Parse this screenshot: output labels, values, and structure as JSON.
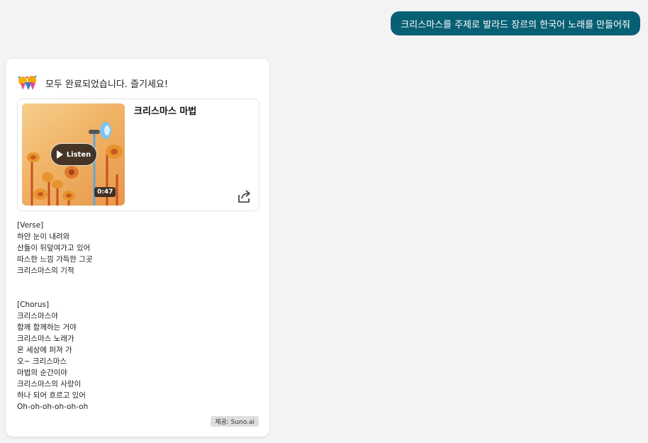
{
  "user_message": "크리스마스를 주제로 발라드 장르의 한국어 노래를 만들어줘",
  "response": {
    "icon": "party-popper-icon",
    "status_text": "모두 완료되었습니다. 즐기세요!",
    "song": {
      "title": "크리스마스 마법",
      "listen_label": "Listen",
      "duration": "0:47"
    },
    "lyrics": {
      "verse_label": "[Verse]",
      "verse": [
        "하얀 눈이 내려와",
        "산들이 뒤덮여가고 있어",
        "따스한 느낌 가득한 그곳",
        "크리스마스의 기적"
      ],
      "chorus_label": "[Chorus]",
      "chorus": [
        "크리스마스야",
        "함께 함께하는 거야",
        "크리스마스 노래가",
        "온 세상에 퍼져 가",
        "오~ 크리스마스",
        "마법의 순간이야",
        "크리스마스의 사랑이",
        "하나 되어 흐르고 있어",
        "Oh-oh-oh-oh-oh-oh"
      ]
    },
    "source_label": "제공: Suno.ai"
  },
  "colors": {
    "user_bubble": "#075f73",
    "background": "#f3f3f3"
  }
}
